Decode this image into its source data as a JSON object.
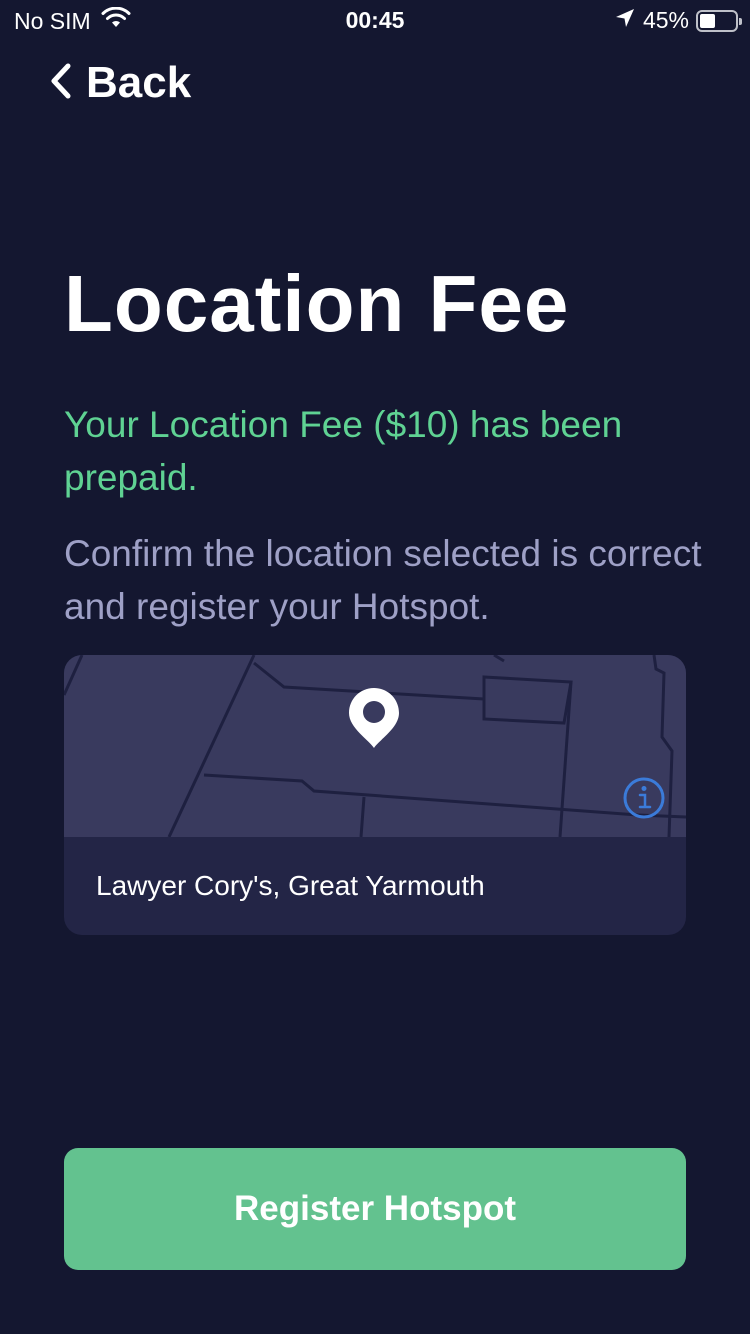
{
  "status_bar": {
    "carrier": "No SIM",
    "time": "00:45",
    "battery_percent_label": "45%",
    "battery_level": 0.45,
    "icons": [
      "wifi-icon",
      "location-arrow-icon",
      "battery-icon"
    ]
  },
  "nav": {
    "back_label": "Back",
    "back_icon": "chevron-left-icon"
  },
  "page": {
    "title": "Location Fee",
    "prepaid_message": "Your Location Fee ($10) has been prepaid.",
    "confirm_message": "Confirm the location selected is correct and register your Hotspot."
  },
  "location_card": {
    "location_name": "Lawyer Cory's, Great Yarmouth",
    "pin_icon": "map-pin-icon",
    "info_icon": "info-icon"
  },
  "actions": {
    "register_label": "Register Hotspot"
  },
  "colors": {
    "background": "#141730",
    "accent_green": "#5fd293",
    "button_green": "#63c28f",
    "muted_text": "#9ea0c6",
    "card_bg": "#232546",
    "map_bg": "#393a5e",
    "info_blue": "#3b7bd9"
  }
}
